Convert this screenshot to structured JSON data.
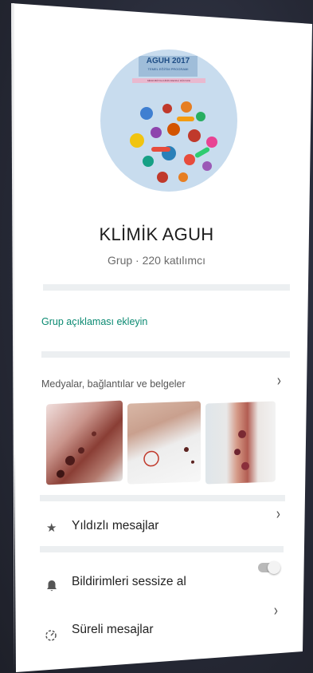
{
  "group": {
    "name": "KLİMİK AGUH",
    "subtitle": "Grup · 220 katılımcı",
    "add_description": "Grup açıklaması ekleyin"
  },
  "avatar": {
    "title": "AGUH 2017",
    "program": "TEMEL EĞİTİM PROGRAMI",
    "strip": "MİKROBİYOLOJİNİN RENKLİ DÜNYASI"
  },
  "media": {
    "label": "Medyalar, bağlantılar ve belgeler",
    "thumbnails": [
      "media-1",
      "media-2",
      "media-3"
    ]
  },
  "rows": {
    "starred": "Yıldızlı mesajlar",
    "mute": "Bildirimleri sessize al",
    "timed": "Süreli mesajlar"
  },
  "colors": {
    "accent": "#0b8a72",
    "divider": "#eceff1"
  },
  "icons": {
    "starred": "star-icon",
    "mute": "bell-icon",
    "timed": "timer-icon"
  }
}
